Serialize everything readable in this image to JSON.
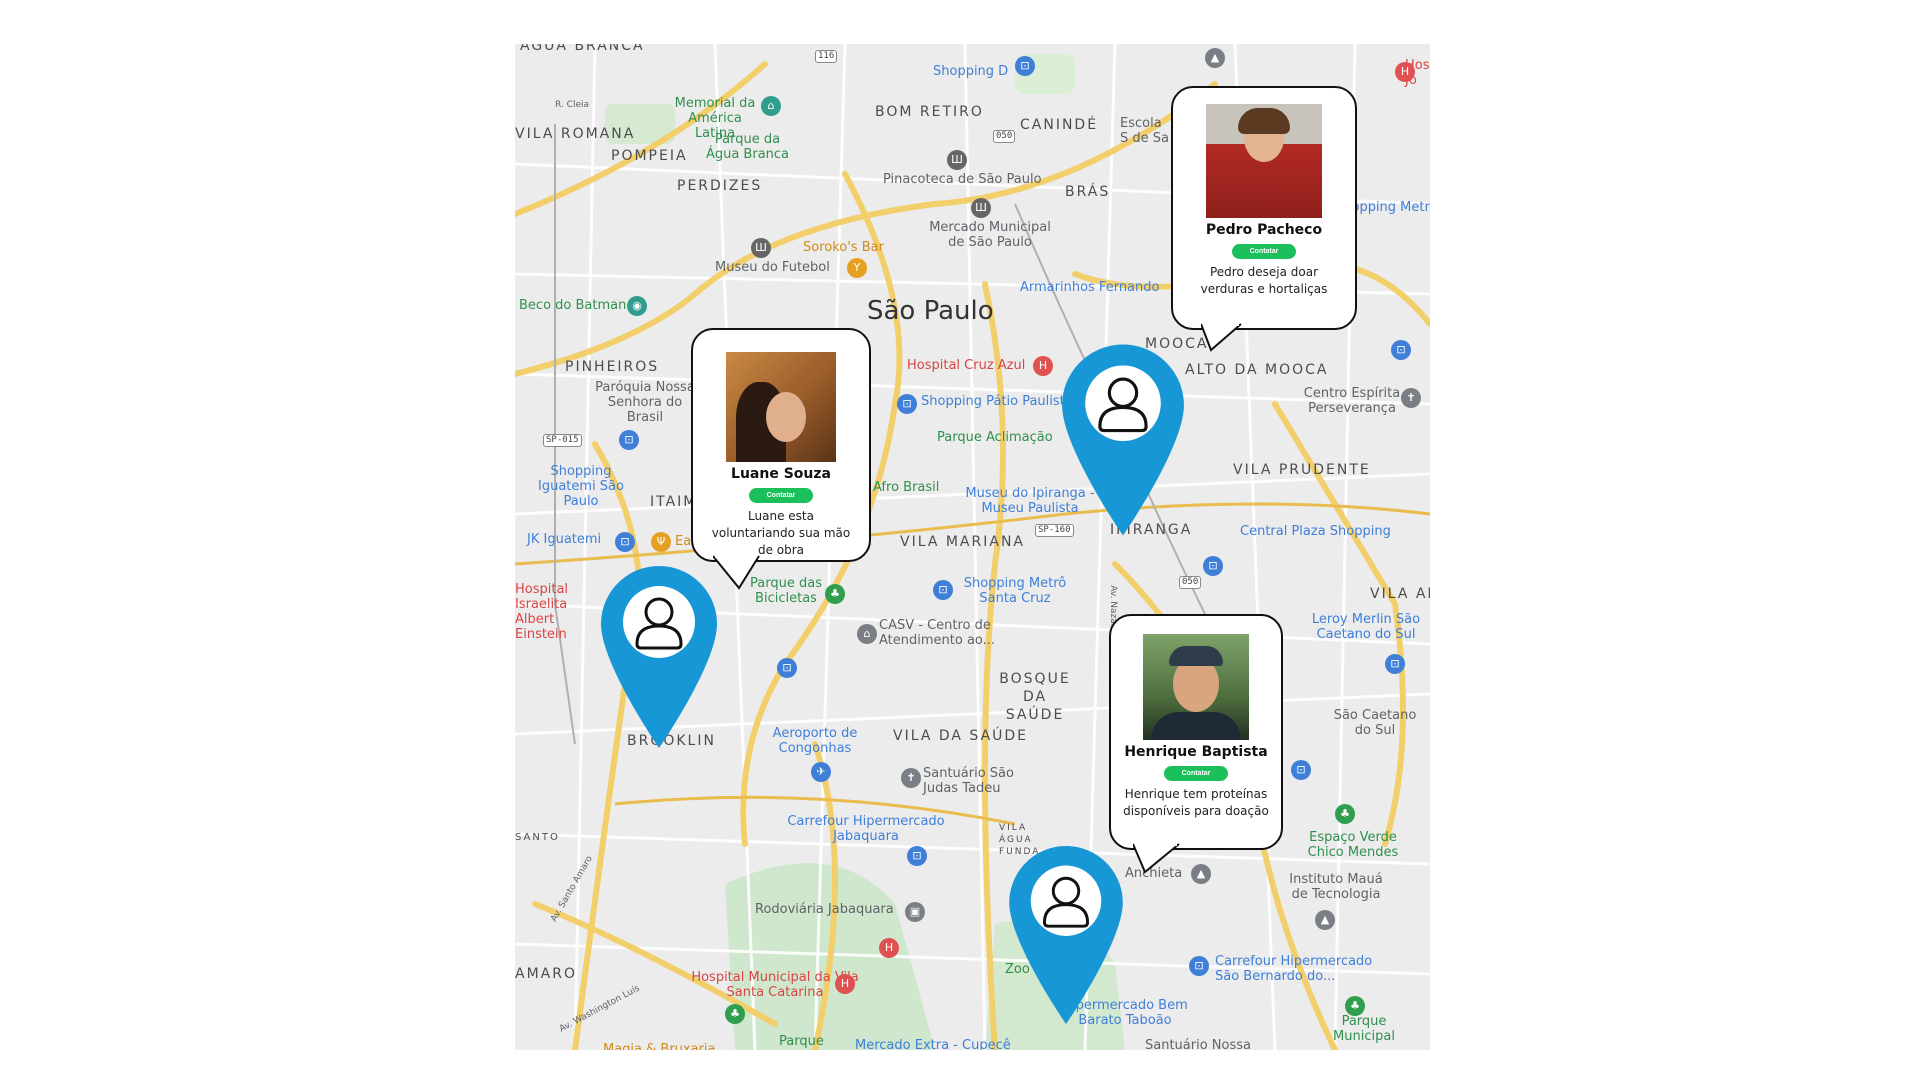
{
  "map": {
    "city_label": "São Paulo",
    "districts": [
      "AGUA BRANCA",
      "VILA ROMANA",
      "POMPEIA",
      "PERDIZES",
      "BOM RETIRO",
      "CANINDÉ",
      "BRÁS",
      "MOOCA",
      "ALTO DA MOOCA",
      "PINHEIROS",
      "ITAIM",
      "VILA MARIANA",
      "IPIRANGA",
      "VILA PRUDENTE",
      "VILA AL",
      "BOSQUE DA SAÚDE",
      "VILA DA SAÚDE",
      "BROOKLIN",
      "SANTO",
      "AMARO",
      "VILA ÁGUA FUNDA"
    ],
    "places": [
      {
        "name": "Memorial da América Latina",
        "color": "green",
        "icon": "museum-icon"
      },
      {
        "name": "Parque da Água Branca",
        "color": "green",
        "icon": "park-icon"
      },
      {
        "name": "Shopping D",
        "color": "blue",
        "icon": "shopping-icon"
      },
      {
        "name": "Escola S de Sa",
        "color": "gray",
        "icon": "school-icon"
      },
      {
        "name": "Pinacoteca de São Paulo",
        "color": "gray",
        "icon": "museum-icon"
      },
      {
        "name": "Mercado Municipal de São Paulo",
        "color": "gray",
        "icon": "market-icon"
      },
      {
        "name": "Soroko's Bar",
        "color": "orange",
        "icon": "bar-icon"
      },
      {
        "name": "Museu do Futebol",
        "color": "gray",
        "icon": "museum-icon"
      },
      {
        "name": "Beco do Batman",
        "color": "green",
        "icon": "camera-icon"
      },
      {
        "name": "Armarinhos Fernando",
        "color": "blue",
        "icon": "shopping-icon"
      },
      {
        "name": "Hospital Cruz Azul",
        "color": "red",
        "icon": "hospital-icon"
      },
      {
        "name": "Shopping Pátio Paulista",
        "color": "blue",
        "icon": "shopping-icon"
      },
      {
        "name": "Parque Aclimação",
        "color": "green",
        "icon": "park-icon"
      },
      {
        "name": "Paróquia Nossa Senhora do Brasil",
        "color": "gray",
        "icon": "church-icon"
      },
      {
        "name": "Shopping Iguatemi São Paulo",
        "color": "blue",
        "icon": "shopping-icon"
      },
      {
        "name": "JK Iguatemi",
        "color": "blue",
        "icon": "shopping-icon"
      },
      {
        "name": "Eataly",
        "color": "orange",
        "icon": "restaurant-icon"
      },
      {
        "name": "Hospital Israelita Albert Einstein",
        "color": "red",
        "icon": "hospital-icon"
      },
      {
        "name": "Parque das Bicicletas",
        "color": "green",
        "icon": "park-icon"
      },
      {
        "name": "Afro Brasil",
        "color": "green",
        "icon": "museum-icon"
      },
      {
        "name": "Museu do Ipiranga - Museu Paulista",
        "color": "blue",
        "icon": "museum-icon"
      },
      {
        "name": "Shopping Metrô Santa Cruz",
        "color": "blue",
        "icon": "shopping-icon"
      },
      {
        "name": "CASV - Centro de Atendimento ao...",
        "color": "gray",
        "icon": "building-icon"
      },
      {
        "name": "Central Plaza Shopping",
        "color": "blue",
        "icon": "shopping-icon"
      },
      {
        "name": "Centro Espírita Perseverança",
        "color": "gray",
        "icon": "church-icon"
      },
      {
        "name": "Leroy Merlin São Caetano do Sul",
        "color": "blue",
        "icon": "shopping-icon"
      },
      {
        "name": "São Caetano do Sul",
        "color": "gray",
        "icon": "city-icon"
      },
      {
        "name": "Aeroporto de Congonhas",
        "color": "blue",
        "icon": "airport-icon"
      },
      {
        "name": "Santuário São Judas Tadeu",
        "color": "gray",
        "icon": "church-icon"
      },
      {
        "name": "Carrefour Hipermercado Jabaquara",
        "color": "blue",
        "icon": "shopping-icon"
      },
      {
        "name": "Rodoviária Jabaquara",
        "color": "gray",
        "icon": "bus-icon"
      },
      {
        "name": "Hospital Municipal da Vila Santa Catarina",
        "color": "red",
        "icon": "hospital-icon"
      },
      {
        "name": "Zoo",
        "color": "green",
        "icon": "park-icon"
      },
      {
        "name": "Carrefour Hipermercado São Bernardo do...",
        "color": "blue",
        "icon": "shopping-icon"
      },
      {
        "name": "Espaço Verde Chico Mendes",
        "color": "green",
        "icon": "park-icon"
      },
      {
        "name": "Instituto Mauá de Tecnologia",
        "color": "gray",
        "icon": "school-icon"
      },
      {
        "name": "Hipermercado Bem Barato Taboão",
        "color": "blue",
        "icon": "shopping-icon"
      },
      {
        "name": "Mercado Extra - Cupecê",
        "color": "blue",
        "icon": "shopping-icon"
      },
      {
        "name": "Magia & Bruxaria",
        "color": "orange",
        "icon": "shop-icon"
      },
      {
        "name": "Parque",
        "color": "green",
        "icon": "park-icon"
      },
      {
        "name": "Parque Municipal",
        "color": "green",
        "icon": "park-icon"
      },
      {
        "name": "Santuário Nossa",
        "color": "gray",
        "icon": "church-icon"
      },
      {
        "name": "Anchieta",
        "color": "gray",
        "icon": "school-icon"
      },
      {
        "name": "Shopping Metrô",
        "color": "blue",
        "icon": "shopping-icon"
      },
      {
        "name": "Hos Jo",
        "color": "red",
        "icon": "hospital-icon"
      }
    ],
    "road_shields": [
      "116",
      "050",
      "SP-015",
      "SP-160",
      "050"
    ],
    "road_names": [
      "R. Cleia",
      "Av. Santo Amaro",
      "Av. Washington Luís",
      "Av. Nazaré"
    ]
  },
  "volunteers": [
    {
      "name": "Pedro Pacheco",
      "button": "Contatar",
      "description": "Pedro deseja doar verduras e hortaliças",
      "photo_bg": "#c23a2b"
    },
    {
      "name": "Luane Souza",
      "button": "Contatar",
      "description": "Luane esta voluntariando sua mão de obra",
      "photo_bg": "#7a4a22"
    },
    {
      "name": "Henrique Baptista",
      "button": "Contatar",
      "description": "Henrique tem proteínas disponíveis para doação",
      "photo_bg": "#4a6b3a"
    }
  ],
  "colors": {
    "pin": "#1897d6",
    "contact_button": "#1bbf5c",
    "map_bg": "#ececec",
    "road_major": "#f5d67a",
    "park": "#c9e8c4"
  }
}
